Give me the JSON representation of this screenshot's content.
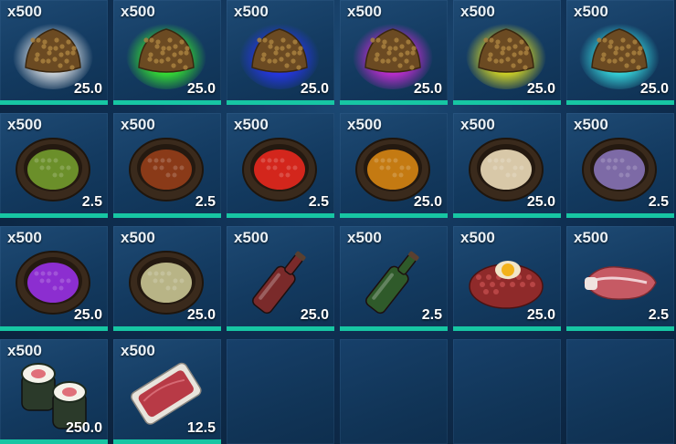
{
  "inventory": {
    "slots": [
      {
        "name": "kibble-basic",
        "qty": "x500",
        "weight": "25.0",
        "icon": "kibble-icon",
        "glow": "#f2f2f2"
      },
      {
        "name": "kibble-simple",
        "qty": "x500",
        "weight": "25.0",
        "icon": "kibble-icon",
        "glow": "#3cff2a"
      },
      {
        "name": "kibble-regular",
        "qty": "x500",
        "weight": "25.0",
        "icon": "kibble-icon",
        "glow": "#2a36ff"
      },
      {
        "name": "kibble-superior",
        "qty": "x500",
        "weight": "25.0",
        "icon": "kibble-icon",
        "glow": "#e02ae6"
      },
      {
        "name": "kibble-exceptional",
        "qty": "x500",
        "weight": "25.0",
        "icon": "kibble-icon",
        "glow": "#f6f21a"
      },
      {
        "name": "kibble-extraordinary",
        "qty": "x500",
        "weight": "25.0",
        "icon": "kibble-icon",
        "glow": "#3df2f2"
      },
      {
        "name": "bowl-green",
        "qty": "x500",
        "weight": "2.5",
        "icon": "bowl-icon",
        "food": "#6b8f2a"
      },
      {
        "name": "bowl-brown",
        "qty": "x500",
        "weight": "2.5",
        "icon": "bowl-icon",
        "food": "#8a3a18"
      },
      {
        "name": "bowl-red",
        "qty": "x500",
        "weight": "2.5",
        "icon": "bowl-icon",
        "food": "#d3261c"
      },
      {
        "name": "bowl-orange",
        "qty": "x500",
        "weight": "25.0",
        "icon": "bowl-icon",
        "food": "#c47a12"
      },
      {
        "name": "bowl-cream",
        "qty": "x500",
        "weight": "25.0",
        "icon": "bowl-icon",
        "food": "#d8c8a8"
      },
      {
        "name": "bowl-lavender",
        "qty": "x500",
        "weight": "2.5",
        "icon": "bowl-icon",
        "food": "#7d6aa6"
      },
      {
        "name": "bowl-purple",
        "qty": "x500",
        "weight": "25.0",
        "icon": "bowl-icon",
        "food": "#8c2ed0"
      },
      {
        "name": "bowl-stew",
        "qty": "x500",
        "weight": "25.0",
        "icon": "bowl-icon",
        "food": "#b8b486"
      },
      {
        "name": "bottle-red",
        "qty": "x500",
        "weight": "25.0",
        "icon": "bottle-icon",
        "liquid": "#7a2a2a"
      },
      {
        "name": "bottle-green",
        "qty": "x500",
        "weight": "2.5",
        "icon": "bottle-icon",
        "liquid": "#2f5a2a"
      },
      {
        "name": "raw-patty",
        "qty": "x500",
        "weight": "25.0",
        "icon": "patty-icon"
      },
      {
        "name": "raw-steak",
        "qty": "x500",
        "weight": "2.5",
        "icon": "steak-icon"
      },
      {
        "name": "sushi-rolls",
        "qty": "x500",
        "weight": "250.0",
        "icon": "sushi-icon"
      },
      {
        "name": "fish-fillet",
        "qty": "x500",
        "weight": "12.5",
        "icon": "fillet-icon"
      },
      {
        "name": "empty",
        "qty": "",
        "weight": "",
        "icon": ""
      },
      {
        "name": "empty",
        "qty": "",
        "weight": "",
        "icon": ""
      },
      {
        "name": "empty",
        "qty": "",
        "weight": "",
        "icon": ""
      },
      {
        "name": "empty",
        "qty": "",
        "weight": "",
        "icon": ""
      }
    ]
  },
  "colors": {
    "bar": "#17c6a3",
    "bowl": "#3a2a1c",
    "kibble": "#6b4a22"
  }
}
